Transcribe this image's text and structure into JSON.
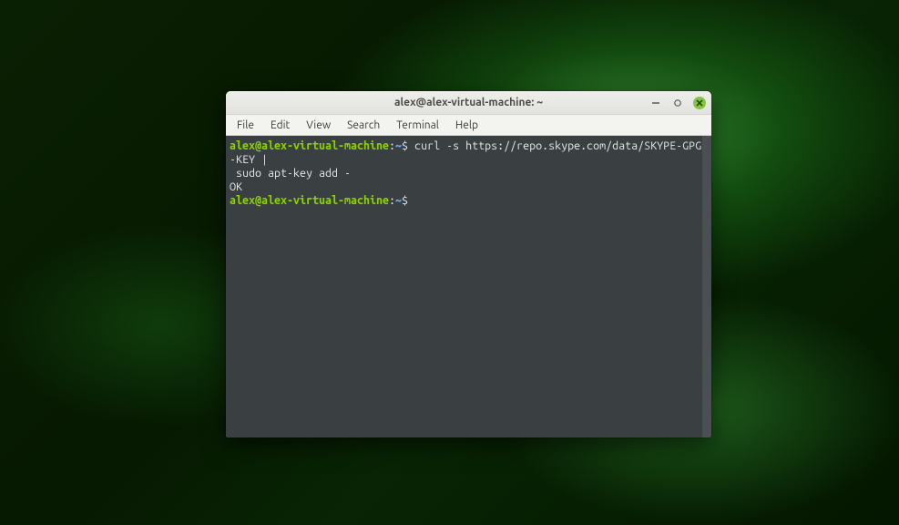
{
  "window": {
    "title": "alex@alex-virtual-machine: ~"
  },
  "menubar": {
    "items": [
      "File",
      "Edit",
      "View",
      "Search",
      "Terminal",
      "Help"
    ]
  },
  "prompt": {
    "userhost": "alex@alex-virtual-machine",
    "sep": ":",
    "path": "~",
    "symbol": "$"
  },
  "terminal": {
    "line1_cmd": " curl -s https://repo.skype.com/data/SKYPE-GPG-KEY |",
    "line2": " sudo apt-key add -",
    "line3": "OK",
    "line4_cmd": " "
  },
  "controls": {
    "minimize": "–",
    "maximize": "❐",
    "close": "×"
  }
}
